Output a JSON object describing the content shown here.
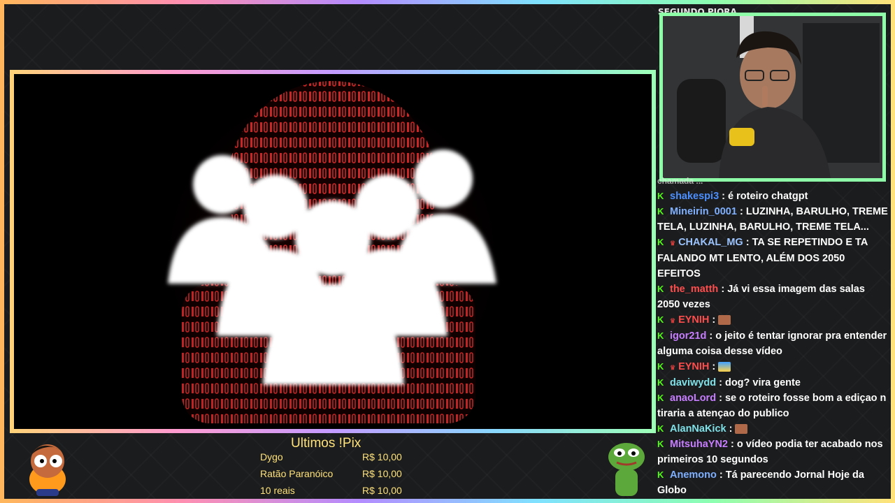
{
  "chat_header": "SEGUNDO PIORA",
  "chat_partial_top": "chamada  ...",
  "chat": [
    {
      "user": "shakespi3",
      "color": "#4b8fff",
      "crown": false,
      "msg": "é roteiro chatgpt"
    },
    {
      "user": "Mineirin_0001",
      "color": "#7fb0ff",
      "crown": false,
      "msg": "LUZINHA, BARULHO, TREME TELA, LUZINHA, BARULHO, TREME TELA..."
    },
    {
      "user": "CHAKAL_MG",
      "color": "#9cc4ff",
      "crown": true,
      "msg": "TA SE REPETINDO E TA FALANDO MT LENTO, ALÉM DOS 2050 EFEITOS"
    },
    {
      "user": "the_matth",
      "color": "#ff4d4d",
      "crown": false,
      "msg": "Já vi essa imagem das salas 2050 vezes"
    },
    {
      "user": "EYNIH",
      "color": "#ff4d4d",
      "crown": true,
      "msg": "",
      "emote": "face"
    },
    {
      "user": "igor21d",
      "color": "#c77dff",
      "crown": false,
      "msg": "o jeito é tentar ignorar pra entender alguma coisa desse vídeo"
    },
    {
      "user": "EYNIH",
      "color": "#ff4d4d",
      "crown": true,
      "msg": "",
      "emote": "wave"
    },
    {
      "user": "daviwydd",
      "color": "#7fe1e8",
      "crown": false,
      "msg": "dog? vira gente"
    },
    {
      "user": "anaoLord",
      "color": "#c77dff",
      "crown": false,
      "msg": "se o roteiro fosse bom a ediçao n tiraria a atençao do publico"
    },
    {
      "user": "AlanNaKick",
      "color": "#7fe1e8",
      "crown": false,
      "msg": "",
      "emote": "face"
    },
    {
      "user": "MitsuhaYN2",
      "color": "#c77dff",
      "crown": false,
      "msg": "o vídeo podia ter acabado nos primeiros 10 segundos"
    },
    {
      "user": "Anemono",
      "color": "#7fb0ff",
      "crown": false,
      "msg": "Tá parecendo Jornal Hoje da Globo"
    }
  ],
  "pix": {
    "title": "Ultimos !Pix",
    "rows": [
      {
        "name": "Dygo",
        "amount": "R$ 10,00"
      },
      {
        "name": "Ratão Paranóico",
        "amount": "R$ 10,00"
      },
      {
        "name": "10 reais",
        "amount": "R$ 10,00"
      }
    ]
  },
  "colors": {
    "pix_text": "#ffe27a",
    "kick_green": "#53fc18",
    "webcam_border": "#8effa8"
  }
}
